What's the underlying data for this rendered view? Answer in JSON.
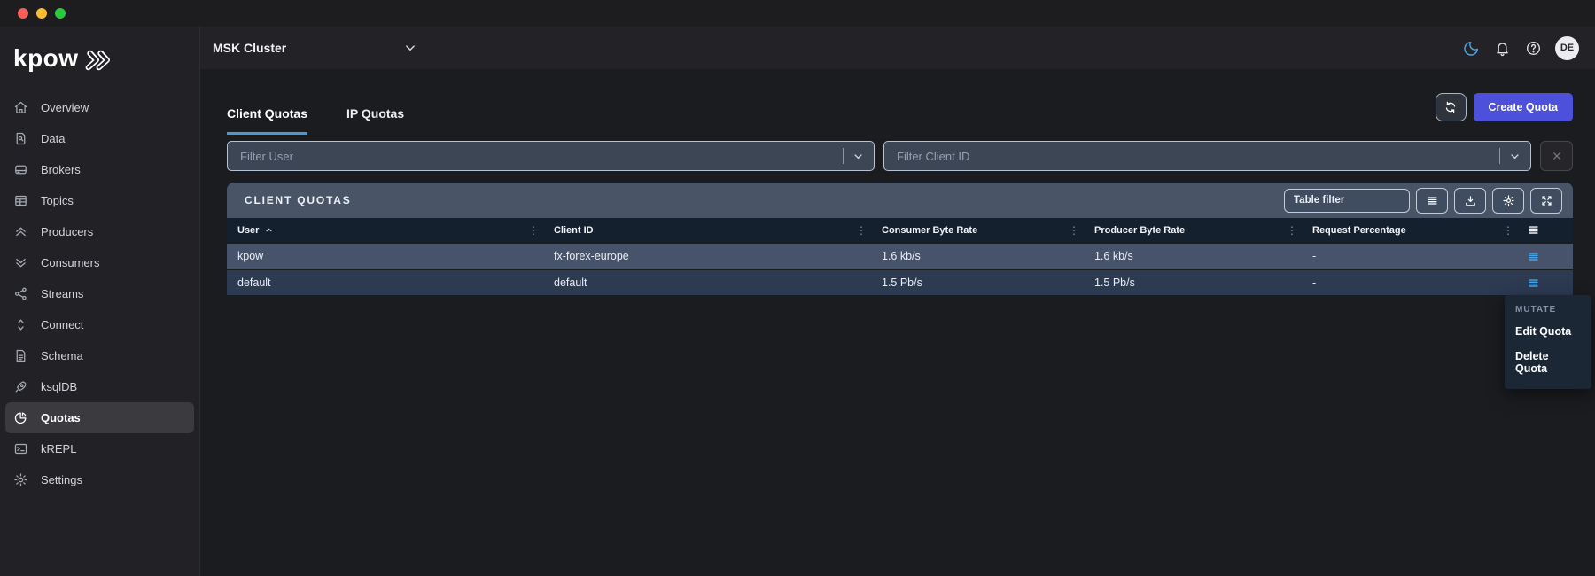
{
  "brand": {
    "logo": "kpow"
  },
  "topbar": {
    "cluster": "MSK Cluster",
    "avatar": "DE",
    "icons": [
      "moon-icon",
      "bell-icon",
      "help-icon"
    ]
  },
  "sidebar": {
    "items": [
      {
        "label": "Overview",
        "icon": "home-icon",
        "active": false
      },
      {
        "label": "Data",
        "icon": "document-search-icon",
        "active": false
      },
      {
        "label": "Brokers",
        "icon": "drive-icon",
        "active": false
      },
      {
        "label": "Topics",
        "icon": "table-icon",
        "active": false
      },
      {
        "label": "Producers",
        "icon": "chevrons-up-icon",
        "active": false
      },
      {
        "label": "Consumers",
        "icon": "chevrons-down-icon",
        "active": false
      },
      {
        "label": "Streams",
        "icon": "share-icon",
        "active": false
      },
      {
        "label": "Connect",
        "icon": "chevrons-vertical-icon",
        "active": false
      },
      {
        "label": "Schema",
        "icon": "document-icon",
        "active": false
      },
      {
        "label": "ksqlDB",
        "icon": "rocket-icon",
        "active": false
      },
      {
        "label": "Quotas",
        "icon": "pie-chart-icon",
        "active": true
      },
      {
        "label": "kREPL",
        "icon": "terminal-icon",
        "active": false
      },
      {
        "label": "Settings",
        "icon": "gear-icon",
        "active": false
      }
    ]
  },
  "tabs": [
    {
      "label": "Client Quotas",
      "active": true
    },
    {
      "label": "IP Quotas",
      "active": false
    }
  ],
  "toolbar": {
    "create_quota_label": "Create Quota",
    "refresh_icon": "refresh-icon"
  },
  "filters": {
    "user_placeholder": "Filter User",
    "client_id_placeholder": "Filter Client ID",
    "clear_icon": "close-icon"
  },
  "table": {
    "title": "CLIENT QUOTAS",
    "filter_placeholder": "Table filter",
    "tool_icons": [
      "list-icon",
      "download-icon",
      "gear-icon",
      "expand-icon"
    ],
    "columns": [
      "User",
      "Client ID",
      "Consumer Byte Rate",
      "Producer Byte Rate",
      "Request Percentage"
    ],
    "sorted_column": "User",
    "sort_direction": "asc",
    "rows": [
      {
        "user": "kpow",
        "client_id": "fx-forex-europe",
        "consumer_byte_rate": "1.6 kb/s",
        "producer_byte_rate": "1.6 kb/s",
        "request_percentage": "-"
      },
      {
        "user": "default",
        "client_id": "default",
        "consumer_byte_rate": "1.5 Pb/s",
        "producer_byte_rate": "1.5 Pb/s",
        "request_percentage": "-"
      }
    ]
  },
  "context_menu": {
    "section_label": "MUTATE",
    "items": [
      {
        "label": "Edit Quota"
      },
      {
        "label": "Delete Quota"
      }
    ]
  },
  "colors": {
    "accent_blue": "#4aa3e6",
    "tab_underline_blue": "#4d96d6",
    "create_button_purple": "#4c50db",
    "card_slate": "#495466",
    "table_header_navy": "#15202f",
    "row_light": "#47536a",
    "row_dark": "#2c3a52"
  }
}
